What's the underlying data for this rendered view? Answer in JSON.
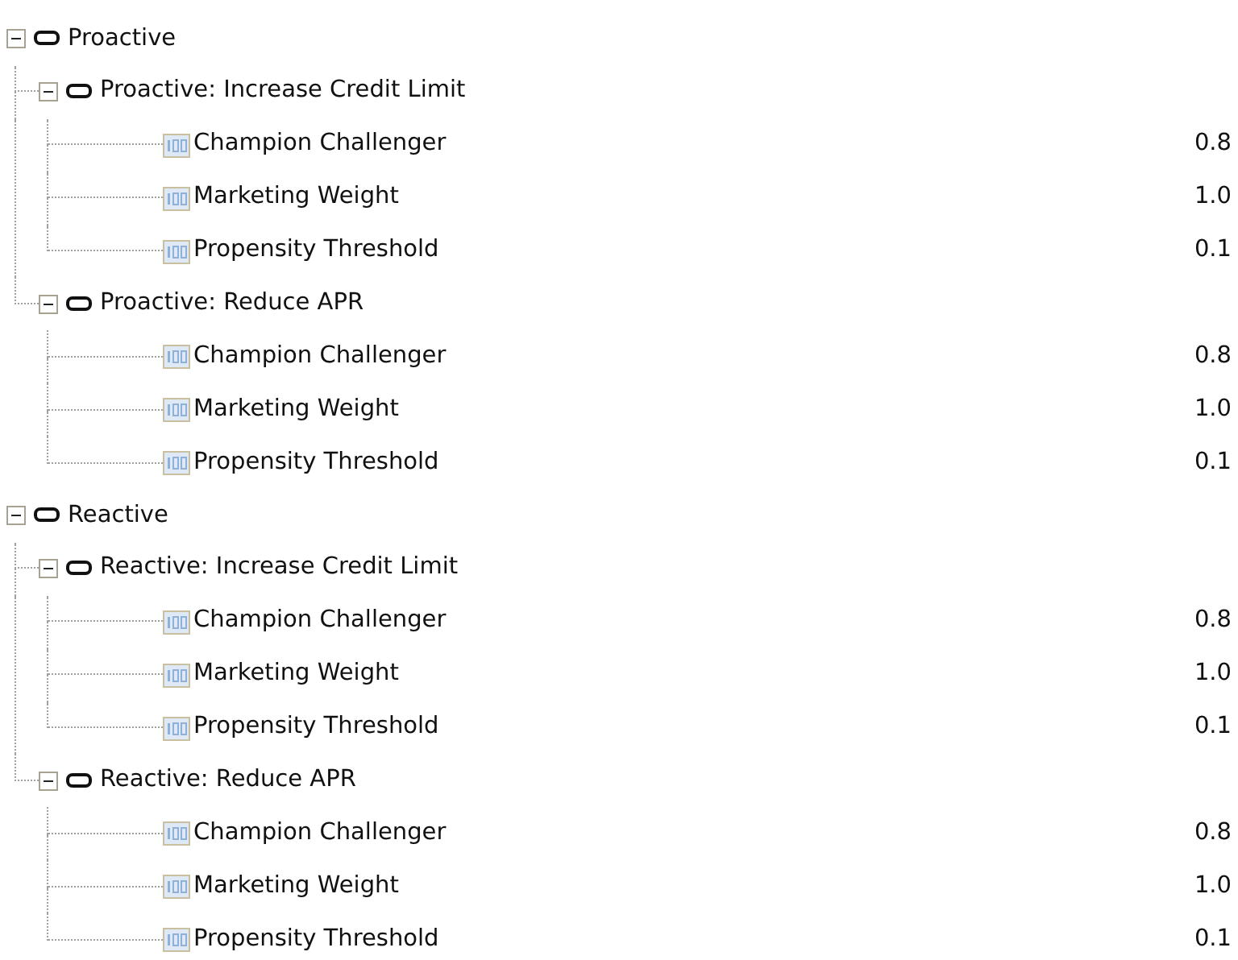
{
  "tree": [
    {
      "label": "Proactive",
      "expanded": true,
      "children": [
        {
          "label": "Proactive: Increase Credit Limit",
          "expanded": true,
          "children": [
            {
              "label": "Champion Challenger",
              "value": "0.8"
            },
            {
              "label": "Marketing Weight",
              "value": "1.0"
            },
            {
              "label": "Propensity Threshold",
              "value": "0.1"
            }
          ]
        },
        {
          "label": "Proactive: Reduce APR",
          "expanded": true,
          "children": [
            {
              "label": "Champion Challenger",
              "value": "0.8"
            },
            {
              "label": "Marketing Weight",
              "value": "1.0"
            },
            {
              "label": "Propensity Threshold",
              "value": "0.1"
            }
          ]
        }
      ]
    },
    {
      "label": "Reactive",
      "expanded": true,
      "children": [
        {
          "label": "Reactive: Increase Credit Limit",
          "expanded": true,
          "children": [
            {
              "label": "Champion Challenger",
              "value": "0.8"
            },
            {
              "label": "Marketing Weight",
              "value": "1.0"
            },
            {
              "label": "Propensity Threshold",
              "value": "0.1"
            }
          ]
        },
        {
          "label": "Reactive: Reduce APR",
          "expanded": true,
          "children": [
            {
              "label": "Champion Challenger",
              "value": "0.8"
            },
            {
              "label": "Marketing Weight",
              "value": "1.0"
            },
            {
              "label": "Propensity Threshold",
              "value": "0.1"
            }
          ]
        }
      ]
    }
  ]
}
